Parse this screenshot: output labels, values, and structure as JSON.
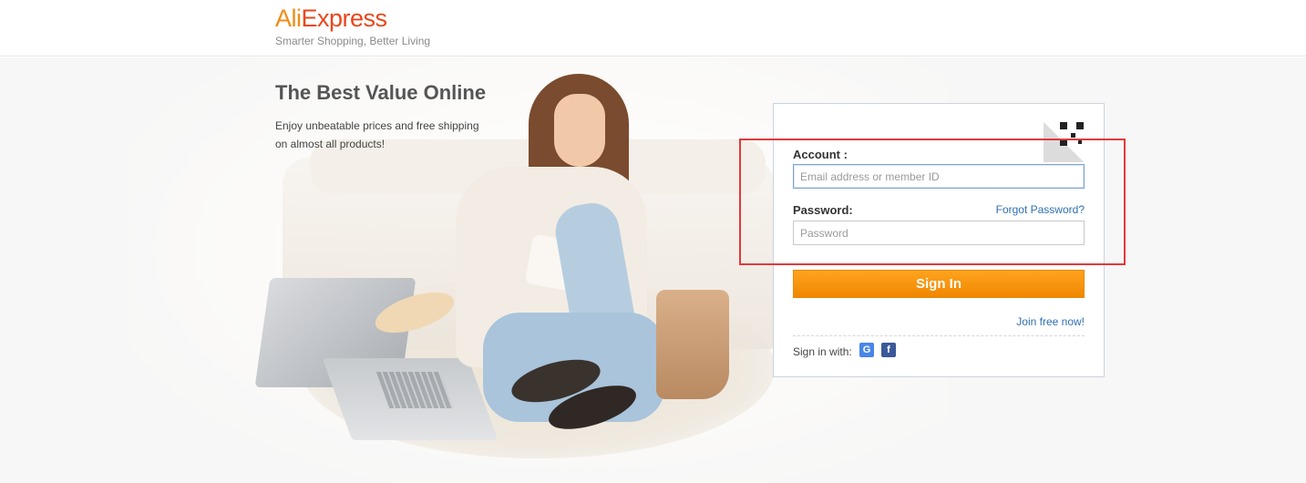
{
  "header": {
    "logo_part1": "Ali",
    "logo_part2": "Express",
    "tagline": "Smarter Shopping, Better Living"
  },
  "hero": {
    "title": "The Best Value Online",
    "desc_line1": "Enjoy unbeatable prices and free shipping",
    "desc_line2": "on almost all products!"
  },
  "login": {
    "account_label": "Account :",
    "account_placeholder": "Email address or member ID",
    "account_value": "",
    "password_label": "Password:",
    "forgot_label": "Forgot Password?",
    "password_placeholder": "Password",
    "password_value": "",
    "signin_label": "Sign In",
    "join_label": "Join free now!",
    "sign_in_with_label": "Sign in with:",
    "google_glyph": "G",
    "facebook_glyph": "f"
  },
  "colors": {
    "brand_orange": "#f08c16",
    "brand_red": "#e8471c",
    "button_orange": "#ff9900",
    "link_blue": "#2f6fb2",
    "highlight_red": "#e0393e"
  }
}
